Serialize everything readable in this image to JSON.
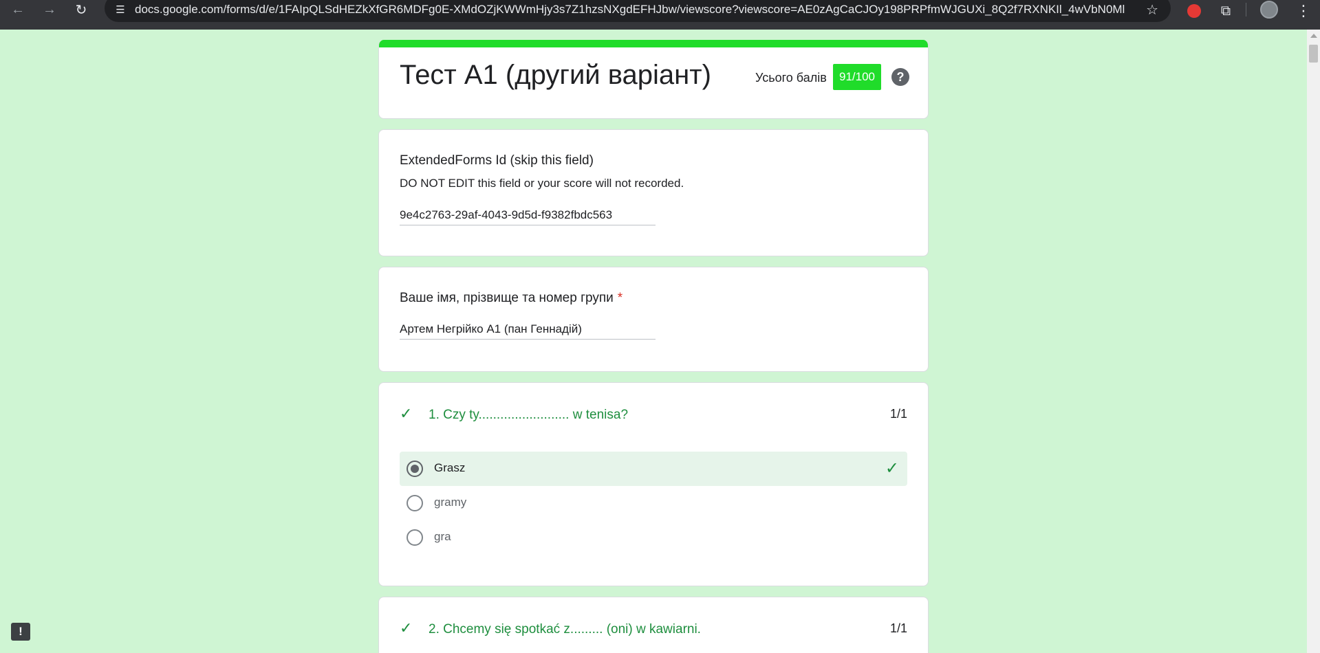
{
  "browser": {
    "back_icon": "←",
    "forward_icon": "→",
    "reload_icon": "↻",
    "site_info_icon": "☰",
    "url": "docs.google.com/forms/d/e/1FAIpQLSdHEZkXfGR6MDFg0E-XMdOZjKWWmHjy3s7Z1hzsNXgdEFHJbw/viewscore?viewscore=AE0zAgCaCJOy198PRPfmWJGUXi_8Q2f7RXNKIl_4wVbN0MlL...",
    "star_icon": "☆",
    "puzzle_icon": "⧉",
    "menu_icon": "⋮"
  },
  "header": {
    "title": "Тест А1 (другий варіант)",
    "score_label": "Усього балів",
    "score": "91/100",
    "help": "?",
    "accent_color": "#20dc2a"
  },
  "extended": {
    "title": "ExtendedForms Id (skip this field)",
    "description": "DO NOT EDIT this field or your score will not recorded.",
    "value": "9e4c2763-29af-4043-9d5d-f9382fbdc563"
  },
  "name_question": {
    "title": "Ваше імя, прізвище та номер групи",
    "required_mark": "*",
    "value": "Артем Негрійко А1 (пан Геннадій)"
  },
  "questions": [
    {
      "check": "✓",
      "title": "1. Czy ty......................... w tenisa?",
      "points": "1/1",
      "options": [
        {
          "label": "Grasz",
          "selected": true,
          "correct_mark": "✓"
        },
        {
          "label": "gramy",
          "selected": false
        },
        {
          "label": "gra",
          "selected": false
        }
      ]
    },
    {
      "check": "✓",
      "title": "2. Chcemy się spotkać z......... (oni) w kawiarni.",
      "points": "1/1"
    }
  ],
  "feedback_icon": "!"
}
